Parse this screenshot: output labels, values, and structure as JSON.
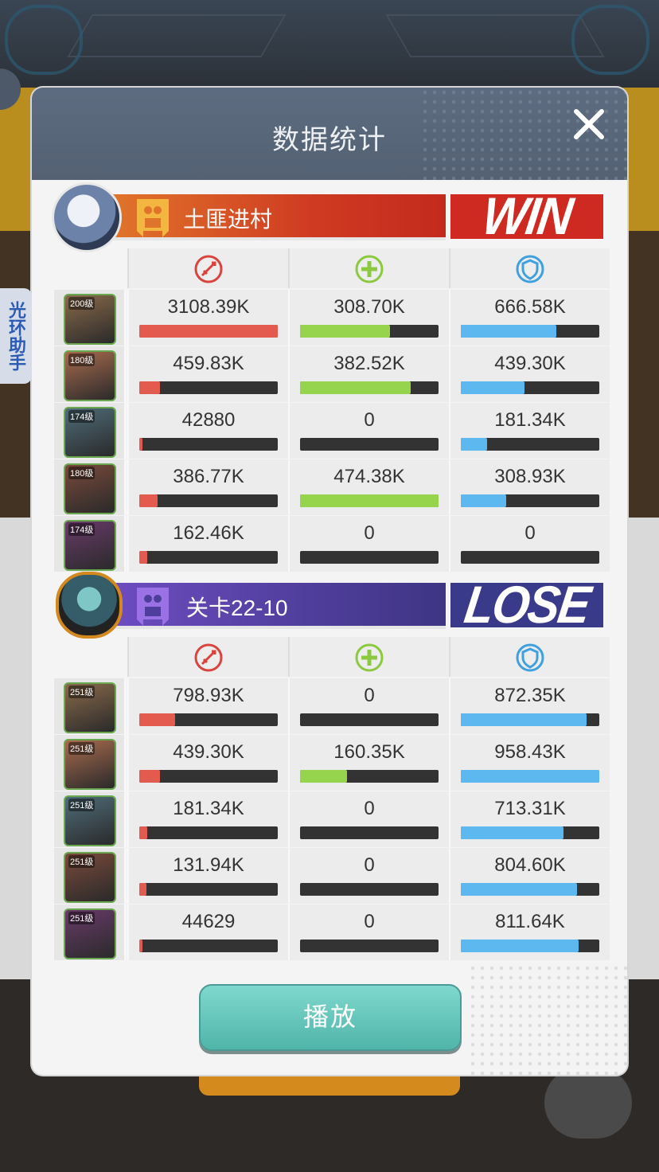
{
  "modal": {
    "title": "数据统计"
  },
  "side_tab": {
    "label": "光环助手"
  },
  "team_win": {
    "name": "土匪进村",
    "result": "WIN",
    "rows": [
      {
        "level": "200级",
        "dmg": "3108.39K",
        "dmg_pct": 100,
        "heal": "308.70K",
        "heal_pct": 65,
        "tank": "666.58K",
        "tank_pct": 69
      },
      {
        "level": "180级",
        "dmg": "459.83K",
        "dmg_pct": 15,
        "heal": "382.52K",
        "heal_pct": 80,
        "tank": "439.30K",
        "tank_pct": 46
      },
      {
        "level": "174级",
        "dmg": "42880",
        "dmg_pct": 2,
        "heal": "0",
        "heal_pct": 0,
        "tank": "181.34K",
        "tank_pct": 19
      },
      {
        "level": "180级",
        "dmg": "386.77K",
        "dmg_pct": 13,
        "heal": "474.38K",
        "heal_pct": 100,
        "tank": "308.93K",
        "tank_pct": 33
      },
      {
        "level": "174级",
        "dmg": "162.46K",
        "dmg_pct": 6,
        "heal": "0",
        "heal_pct": 0,
        "tank": "0",
        "tank_pct": 0
      }
    ]
  },
  "team_lose": {
    "name": "关卡22-10",
    "result": "LOSE",
    "rows": [
      {
        "level": "251级",
        "dmg": "798.93K",
        "dmg_pct": 26,
        "heal": "0",
        "heal_pct": 0,
        "tank": "872.35K",
        "tank_pct": 91
      },
      {
        "level": "251级",
        "dmg": "439.30K",
        "dmg_pct": 15,
        "heal": "160.35K",
        "heal_pct": 34,
        "tank": "958.43K",
        "tank_pct": 100
      },
      {
        "level": "251级",
        "dmg": "181.34K",
        "dmg_pct": 6,
        "heal": "0",
        "heal_pct": 0,
        "tank": "713.31K",
        "tank_pct": 74
      },
      {
        "level": "251级",
        "dmg": "131.94K",
        "dmg_pct": 5,
        "heal": "0",
        "heal_pct": 0,
        "tank": "804.60K",
        "tank_pct": 84
      },
      {
        "level": "251级",
        "dmg": "44629",
        "dmg_pct": 2,
        "heal": "0",
        "heal_pct": 0,
        "tank": "811.64K",
        "tank_pct": 85
      }
    ]
  },
  "play_button": {
    "label": "播放"
  },
  "icons": {
    "damage": "sword-damage-icon",
    "heal": "heal-plus-icon",
    "tank": "shield-icon",
    "close": "close-icon"
  },
  "colors": {
    "damage": "#e35a4f",
    "heal": "#97d44d",
    "tank": "#5cb8ee",
    "win": "#cf2a22",
    "lose": "#3a3a8a"
  }
}
